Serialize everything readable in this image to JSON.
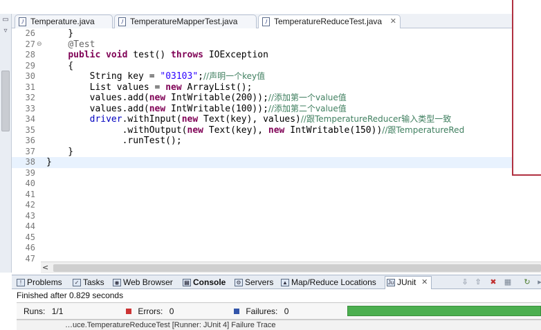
{
  "editor_tabs": [
    {
      "label": "Temperature.java"
    },
    {
      "label": "TemperatureMapperTest.java"
    },
    {
      "label": "TemperatureReduceTest.java",
      "close": "✕"
    }
  ],
  "code_lines": [
    {
      "num": "26",
      "text": "    }"
    },
    {
      "num": "27",
      "text": "    @Test"
    },
    {
      "num": "28",
      "text": "    public void test() throws IOException"
    },
    {
      "num": "29",
      "text": "    {"
    },
    {
      "num": "30",
      "text": "        String key = \"03103\";//声明一个key值"
    },
    {
      "num": "31",
      "text": "        List values = new ArrayList();"
    },
    {
      "num": "32",
      "text": "        values.add(new IntWritable(200));//添加第一个value值"
    },
    {
      "num": "33",
      "text": "        values.add(new IntWritable(100));//添加第二个value值"
    },
    {
      "num": "34",
      "text": "        driver.withInput(new Text(key), values)//跟TemperatureReducer输入类型一致"
    },
    {
      "num": "35",
      "text": "              .withOutput(new Text(key), new IntWritable(150))//跟TemperatureRed"
    },
    {
      "num": "36",
      "text": "              .runTest();"
    },
    {
      "num": "37",
      "text": "    }"
    },
    {
      "num": "38",
      "text": "}"
    },
    {
      "num": "39",
      "text": ""
    },
    {
      "num": "40",
      "text": ""
    },
    {
      "num": "41",
      "text": ""
    },
    {
      "num": "42",
      "text": ""
    },
    {
      "num": "43",
      "text": ""
    },
    {
      "num": "44",
      "text": ""
    },
    {
      "num": "45",
      "text": ""
    },
    {
      "num": "46",
      "text": ""
    },
    {
      "num": "47",
      "text": ""
    }
  ],
  "view_tabs": [
    {
      "label": "Problems",
      "icon": "problems-icon"
    },
    {
      "label": "Tasks",
      "icon": "tasks-icon"
    },
    {
      "label": "Web Browser",
      "icon": "globe-icon"
    },
    {
      "label": "Console",
      "icon": "console-icon"
    },
    {
      "label": "Servers",
      "icon": "servers-icon"
    },
    {
      "label": "Map/Reduce Locations",
      "icon": "elephant-icon"
    },
    {
      "label": "JUnit",
      "icon": "junit-icon",
      "close": "✕"
    }
  ],
  "junit": {
    "status": "Finished after 0.829 seconds",
    "runs_label": "Runs:",
    "runs_value": "1/1",
    "errors_label": "Errors:",
    "errors_value": "0",
    "failures_label": "Failures:",
    "failures_value": "0",
    "progress": 1.0,
    "progress_color": "#4caf50",
    "bottom_text": "…uce.TemperatureReduceTest [Runner: JUnit 4]    Failure Trace"
  },
  "colors": {
    "keyword": "#7f0055",
    "string": "#2a00ff",
    "comment": "#3f7f5f",
    "annotation": "#646464",
    "field": "#0000c0",
    "current_line": "#e8f2fe",
    "errors_icon": "#cc3333",
    "failures_icon": "#3355aa"
  }
}
